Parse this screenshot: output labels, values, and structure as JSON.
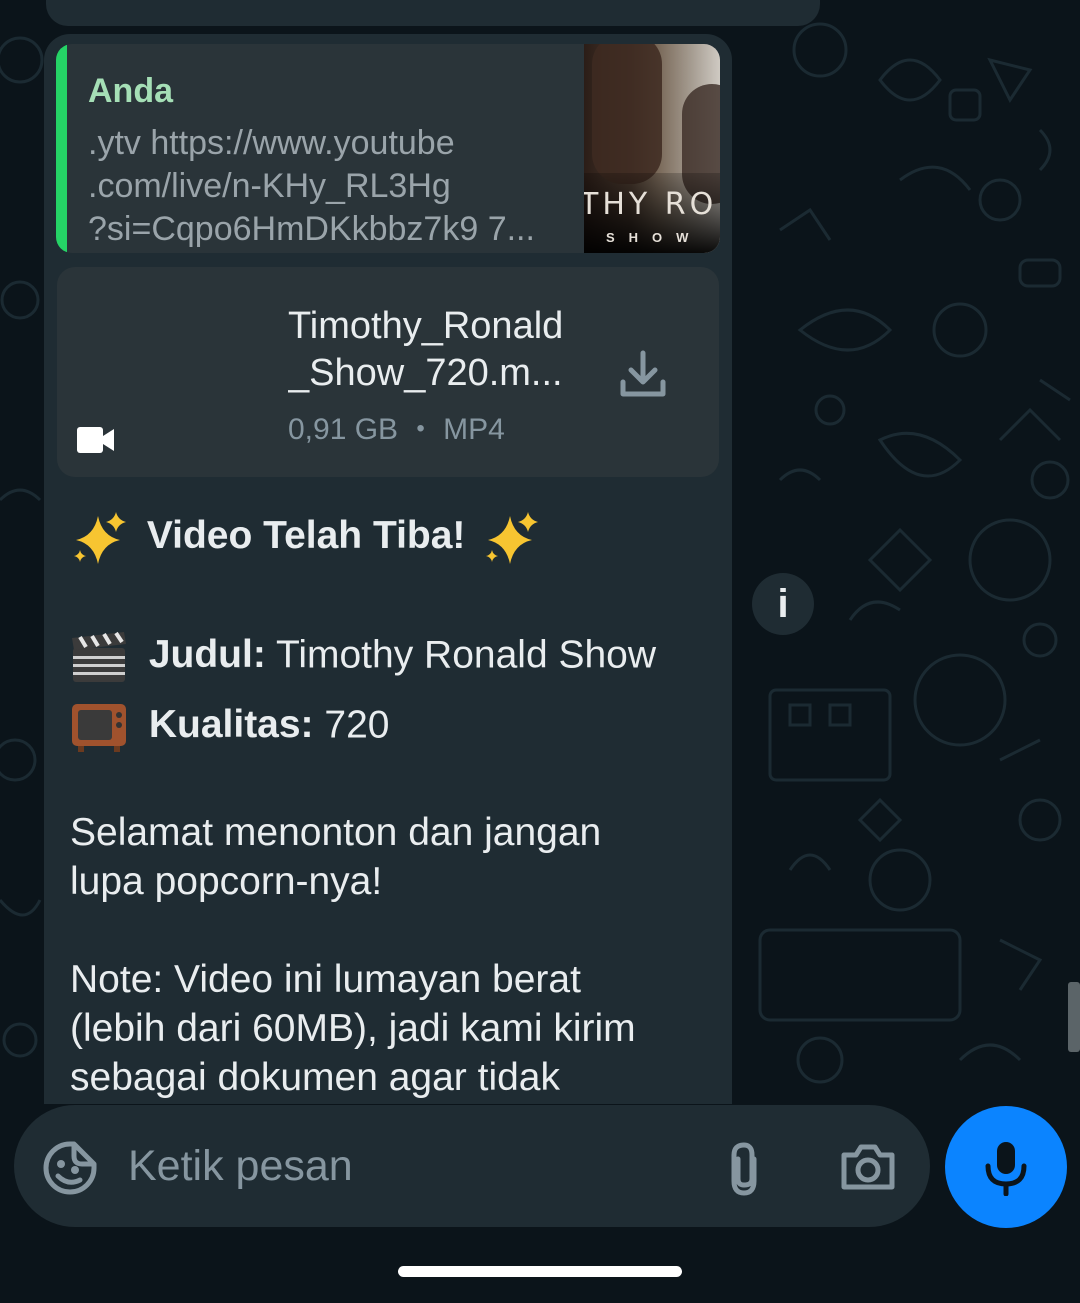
{
  "quoted_message": {
    "author": "Anda",
    "text_lines": [
      ".ytv https://www.youtube",
      ".com/live/n-KHy_RL3Hg",
      "?si=Cqpo6HmDKkbbz7k9 7..."
    ],
    "thumbnail_title": "THY RO",
    "thumbnail_subtitle": "SHOW"
  },
  "document": {
    "name_lines": [
      "Timothy_Ronald",
      "_Show_720.m..."
    ],
    "size": "0,91 GB",
    "separator": "•",
    "type": "MP4"
  },
  "message": {
    "headline": "Video Telah Tiba!",
    "title_label": "Judul:",
    "title_value": "Timothy Ronald Show",
    "quality_label": "Kualitas:",
    "quality_value": "720",
    "paragraph1_lines": [
      "Selamat menonton dan jangan",
      "lupa popcorn-nya!"
    ],
    "paragraph2_lines": [
      "Note: Video ini lumayan berat",
      "(lebih dari 60MB), jadi kami kirim",
      "sebagai dokumen agar tidak"
    ]
  },
  "info_button_label": "i",
  "composer": {
    "placeholder": "Ketik pesan"
  },
  "icons": {
    "sticker": "sticker-icon",
    "attach": "paperclip-icon",
    "camera": "camera-icon",
    "mic": "microphone-icon",
    "download": "download-icon",
    "video": "video-camera-icon"
  },
  "colors": {
    "background": "#0b141a",
    "bubble": "#1f2c33",
    "quote_accent": "#25d366",
    "mic_button": "#0b84ff"
  }
}
